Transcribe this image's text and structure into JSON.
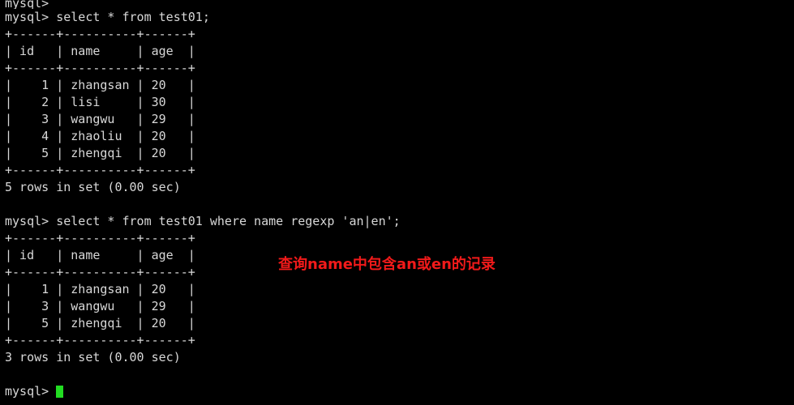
{
  "terminal": {
    "prompt": "mysql>",
    "top_partial_line": "mysql>",
    "lines": [
      "mysql> select * from test01;",
      "+------+----------+------+",
      "| id   | name     | age  |",
      "+------+----------+------+",
      "|    1 | zhangsan | 20   |",
      "|    2 | lisi     | 30   |",
      "|    3 | wangwu   | 29   |",
      "|    4 | zhaoliu  | 20   |",
      "|    5 | zhengqi  | 20   |",
      "+------+----------+------+",
      "5 rows in set (0.00 sec)",
      "",
      "mysql> select * from test01 where name regexp 'an|en';",
      "+------+----------+------+",
      "| id   | name     | age  |",
      "+------+----------+------+",
      "|    1 | zhangsan | 20   |",
      "|    3 | wangwu   | 29   |",
      "|    5 | zhengqi  | 20   |",
      "+------+----------+------+",
      "3 rows in set (0.00 sec)",
      ""
    ],
    "final_prompt": "mysql> ",
    "annotation": {
      "text": "查询name中包含an或en的记录",
      "color": "#f21a1a"
    },
    "colors": {
      "background": "#000000",
      "foreground": "#d8d8d8",
      "cursor": "#22dd22"
    }
  }
}
